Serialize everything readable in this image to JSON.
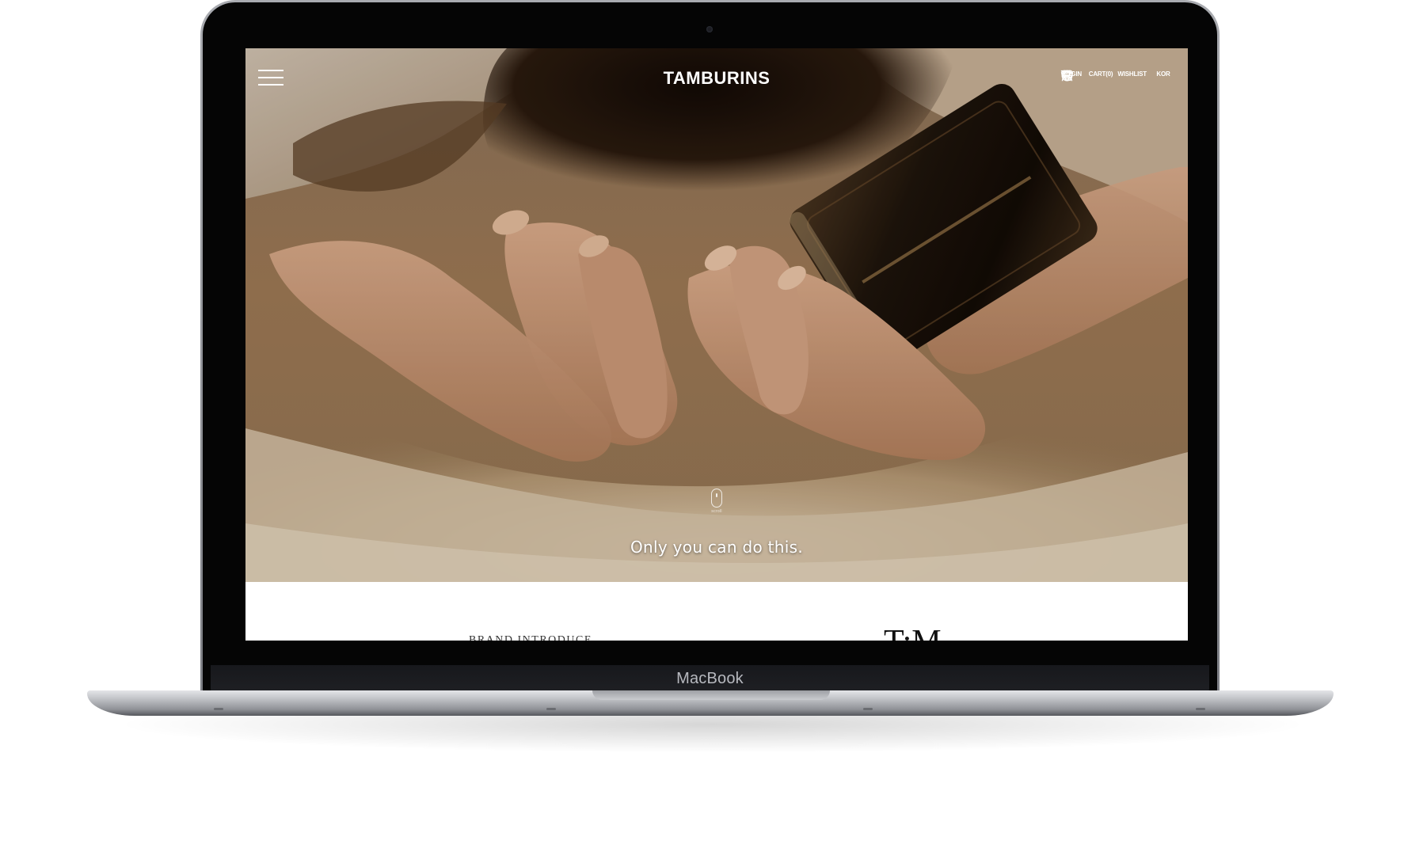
{
  "device": {
    "brand_label": "MacBook"
  },
  "header": {
    "logo": "TAMBURINS",
    "menu_icon": "hamburger-menu-icon",
    "utils": [
      {
        "label": "LOGIN",
        "icon": "user-icon"
      },
      {
        "label": "CART(0)",
        "icon": "cart-icon"
      },
      {
        "label": "WISHLIST",
        "icon": "heart-icon"
      },
      {
        "label": "KOR",
        "icon": "globe-icon"
      }
    ]
  },
  "hero": {
    "subtitle": "Only you can do this.",
    "scroll_label": "scroll"
  },
  "section": {
    "title": "BRAND INTRODUCE",
    "emblem": "T:M"
  },
  "colors": {
    "hero_dark": "#2a1a0e",
    "hero_warm": "#a07a52",
    "sheet_light": "#d8c9b2",
    "text_on_hero": "#ffffff"
  }
}
